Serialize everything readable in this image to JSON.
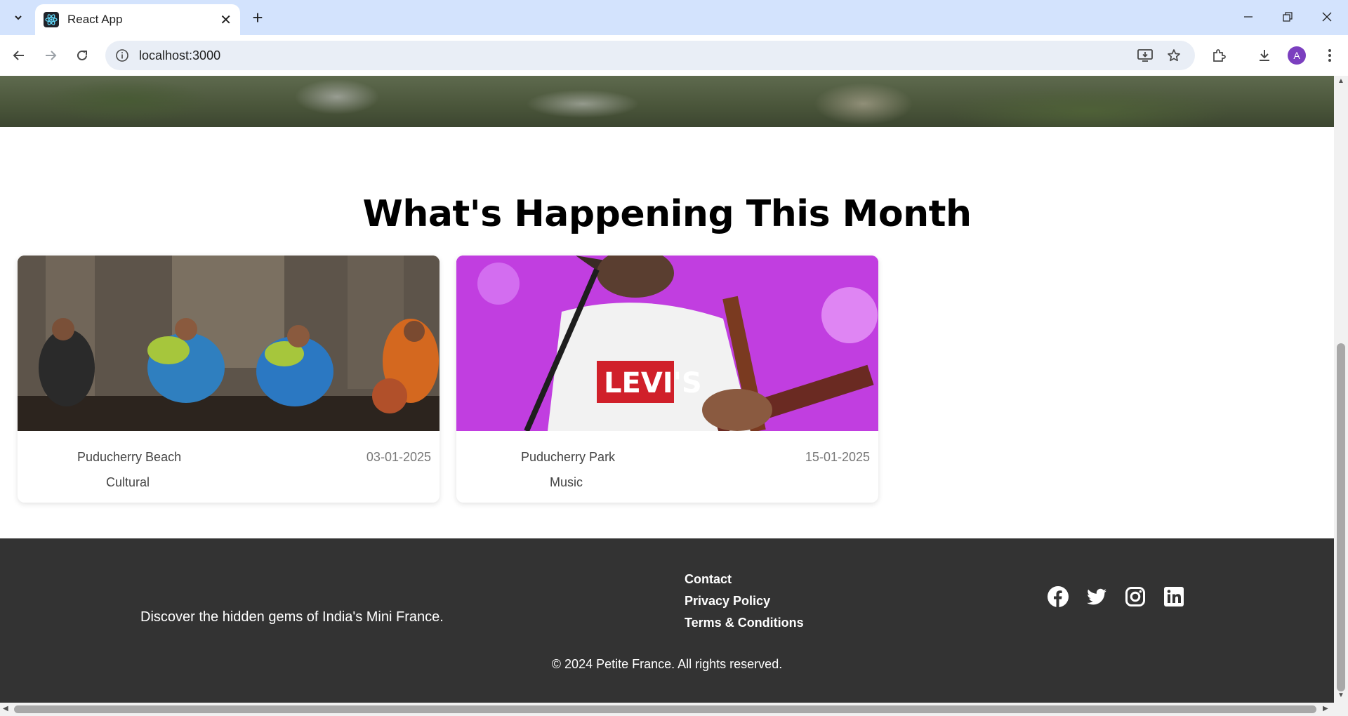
{
  "browser": {
    "tab_title": "React App",
    "url": "localhost:3000",
    "avatar_letter": "A"
  },
  "section": {
    "title": "What's Happening This Month"
  },
  "events": [
    {
      "location": "Puducherry Beach",
      "date": "03-01-2025",
      "category": "Cultural",
      "image": "cultural-performance-photo"
    },
    {
      "location": "Puducherry Park",
      "date": "15-01-2025",
      "category": "Music",
      "image": "guitarist-concert-photo"
    }
  ],
  "footer": {
    "tagline": "Discover the hidden gems of India's Mini France.",
    "links": [
      "Contact",
      "Privacy Policy",
      "Terms & Conditions"
    ],
    "social": [
      "facebook-icon",
      "twitter-icon",
      "instagram-icon",
      "linkedin-icon"
    ],
    "copyright": "© 2024 Petite France. All rights reserved."
  },
  "colors": {
    "tabbar": "#d3e3fd",
    "footer_bg": "#333333",
    "avatar": "#7b3fbf"
  }
}
